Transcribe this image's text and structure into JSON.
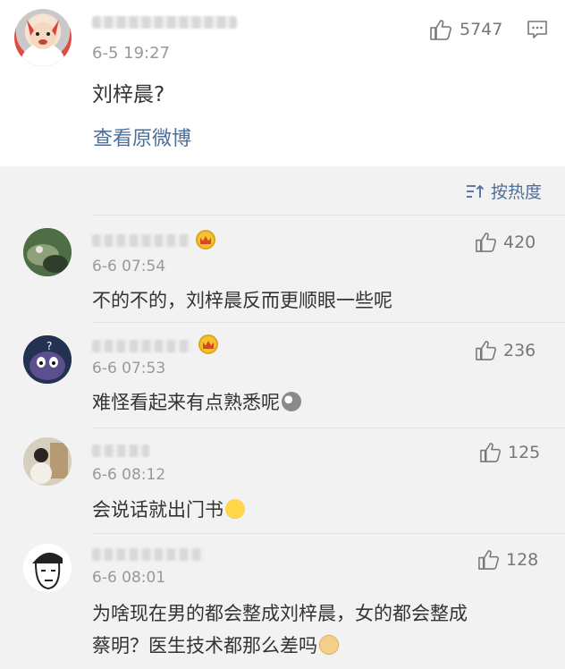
{
  "main_post": {
    "time": "6-5 19:27",
    "text": "刘梓晨?",
    "likes": "5747",
    "view_original": "查看原微博"
  },
  "sort": {
    "label": "按热度"
  },
  "comments": [
    {
      "time": "6-6 07:54",
      "text": "不的不的，刘梓晨反而更顺眼一些呢",
      "likes": "420"
    },
    {
      "time": "6-6 07:53",
      "text": "难怪看起来有点熟悉呢",
      "likes": "236"
    },
    {
      "time": "6-6 08:12",
      "text": "会说话就出门书",
      "likes": "125"
    },
    {
      "time": "6-6 08:01",
      "text_line1": "为啥现在男的都会整成刘梓晨，女的都会整成",
      "text_line2": "蔡明？医生技术都那么差吗",
      "likes": "128"
    }
  ],
  "colors": {
    "link": "#4e6e9a",
    "time": "#999999",
    "background": "#f2f2f2"
  }
}
